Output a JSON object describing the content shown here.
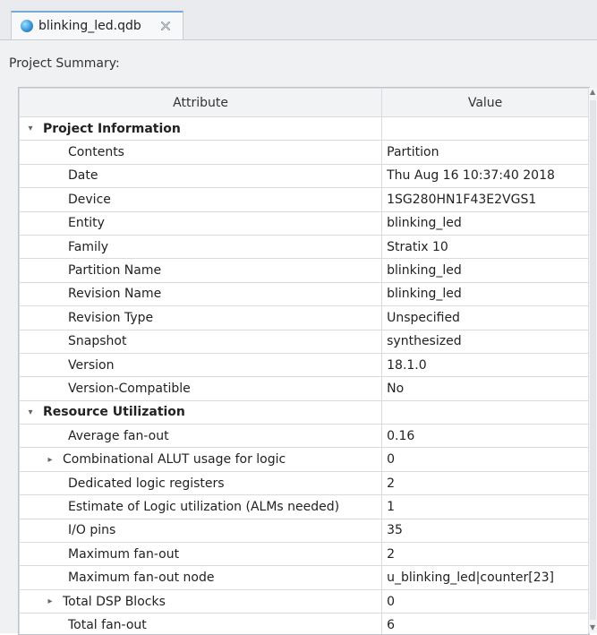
{
  "tab": {
    "title": "blinking_led.qdb",
    "icon": "database-icon",
    "close_icon": "close-icon"
  },
  "panel": {
    "label": "Project Summary:"
  },
  "table": {
    "columns": [
      "Attribute",
      "Value"
    ],
    "rows": [
      {
        "type": "section",
        "expanded": true,
        "attribute": "Project Information",
        "value": ""
      },
      {
        "type": "row",
        "attribute": "Contents",
        "value": "Partition"
      },
      {
        "type": "row",
        "attribute": "Date",
        "value": "Thu Aug 16 10:37:40 2018"
      },
      {
        "type": "row",
        "attribute": "Device",
        "value": "1SG280HN1F43E2VGS1"
      },
      {
        "type": "row",
        "attribute": "Entity",
        "value": "blinking_led"
      },
      {
        "type": "row",
        "attribute": "Family",
        "value": "Stratix 10"
      },
      {
        "type": "row",
        "attribute": "Partition Name",
        "value": "blinking_led"
      },
      {
        "type": "row",
        "attribute": "Revision Name",
        "value": "blinking_led"
      },
      {
        "type": "row",
        "attribute": "Revision Type",
        "value": "Unspecified"
      },
      {
        "type": "row",
        "attribute": "Snapshot",
        "value": "synthesized"
      },
      {
        "type": "row",
        "attribute": "Version",
        "value": "18.1.0"
      },
      {
        "type": "row",
        "attribute": "Version-Compatible",
        "value": "No"
      },
      {
        "type": "section",
        "expanded": true,
        "attribute": "Resource Utilization",
        "value": ""
      },
      {
        "type": "row",
        "attribute": "Average fan-out",
        "value": "0.16"
      },
      {
        "type": "row",
        "collapsed": true,
        "attribute": "Combinational ALUT usage for logic",
        "value": "0"
      },
      {
        "type": "row",
        "attribute": "Dedicated logic registers",
        "value": "2"
      },
      {
        "type": "row",
        "attribute": "Estimate of Logic utilization (ALMs needed)",
        "value": "1"
      },
      {
        "type": "row",
        "attribute": "I/O pins",
        "value": "35"
      },
      {
        "type": "row",
        "attribute": "Maximum fan-out",
        "value": "2"
      },
      {
        "type": "row",
        "attribute": "Maximum fan-out node",
        "value": "u_blinking_led|counter[23]"
      },
      {
        "type": "row",
        "collapsed": true,
        "attribute": "Total DSP Blocks",
        "value": "0"
      },
      {
        "type": "row",
        "attribute": "Total fan-out",
        "value": "6"
      }
    ]
  },
  "scrollbar": {
    "up": "▲",
    "down": "▼"
  }
}
